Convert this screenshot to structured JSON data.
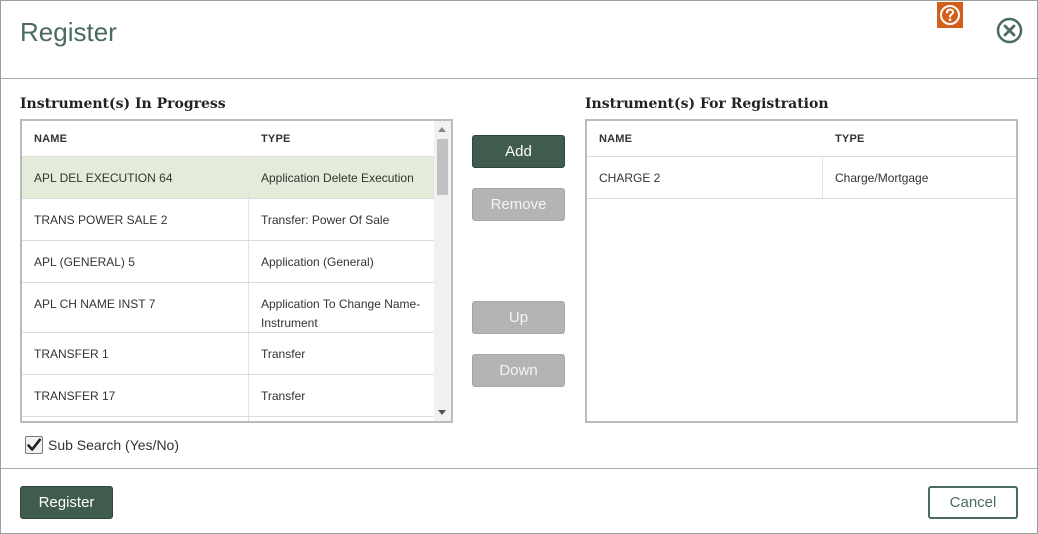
{
  "dialog": {
    "title": "Register",
    "accent_color": "#3f5c4f",
    "help_icon": "question-circle-icon",
    "close_icon": "close-circle-icon"
  },
  "in_progress": {
    "title": "Instrument(s) In Progress",
    "columns": [
      "NAME",
      "TYPE"
    ],
    "rows": [
      {
        "name": "APL DEL EXECUTION 64",
        "type": "Application Delete Execution",
        "selected": true
      },
      {
        "name": "TRANS POWER SALE 2",
        "type": "Transfer: Power Of Sale",
        "selected": false
      },
      {
        "name": "APL (GENERAL) 5",
        "type": "Application (General)",
        "selected": false
      },
      {
        "name": "APL CH NAME INST 7",
        "type": "Application To Change Name-Instrument",
        "selected": false
      },
      {
        "name": "TRANSFER 1",
        "type": "Transfer",
        "selected": false
      },
      {
        "name": "TRANSFER 17",
        "type": "Transfer",
        "selected": false
      },
      {
        "name": "",
        "type": "",
        "selected": false
      }
    ]
  },
  "for_registration": {
    "title": "Instrument(s) For Registration",
    "columns": [
      "NAME",
      "TYPE"
    ],
    "rows": [
      {
        "name": "CHARGE 2",
        "type": "Charge/Mortgage"
      }
    ]
  },
  "actions": {
    "add": "Add",
    "remove": "Remove",
    "up": "Up",
    "down": "Down"
  },
  "sub_search": {
    "label": "Sub Search (Yes/No)",
    "checked": true
  },
  "footer": {
    "register": "Register",
    "cancel": "Cancel"
  }
}
